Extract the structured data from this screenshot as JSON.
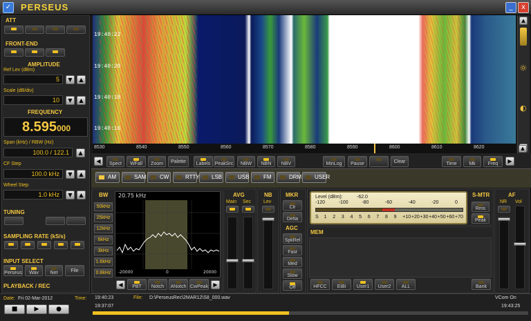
{
  "app": {
    "title": "PERSEUS",
    "icon": "app-icon"
  },
  "window": {
    "minimize_label": "_",
    "close_label": "x"
  },
  "left": {
    "att_title": "ATT",
    "frontend_title": "FRONT-END",
    "amplitude_title": "AMPLITUDE",
    "ref_lev_label": "Ref Lev (dBm)",
    "ref_lev_value": "5",
    "scale_label": "Scale (dB/div)",
    "scale_value": "10",
    "frequency_title": "FREQUENCY",
    "freq_main": "8.595",
    "freq_sub": "000",
    "span_label": "Span (kHz) / RBW (Hz)",
    "span_value": "100.0 / 122.1",
    "cfstep_label": "CF Step",
    "cfstep_value": "100.0 kHz",
    "wheelstep_label": "Wheel Step",
    "wheelstep_value": "1.0 kHz",
    "tuning_title": "TUNING",
    "sampling_title": "SAMPLING RATE (kS/s)",
    "input_title": "INPUT SELECT",
    "input_buttons": [
      "Perseus",
      "Wav",
      "Net",
      "File"
    ],
    "playback_title": "PLAYBACK / REC"
  },
  "waterfall": {
    "timestamps": [
      "19:40:22",
      "19:40:20",
      "19:40:18",
      "19:40:16"
    ]
  },
  "freq_axis": {
    "ticks": [
      "8530",
      "8540",
      "8550",
      "8560",
      "8570",
      "8580",
      "8590",
      "8600",
      "8610",
      "8620"
    ]
  },
  "toolbar": {
    "left_buttons": [
      "Spect",
      "WFall",
      "Zoom",
      "Palette",
      "Labels",
      "PeakSrc",
      "NBW",
      "NBN",
      "NBV",
      "MinLog",
      "Pause",
      "",
      "Clear"
    ],
    "right_buttons": [
      "Time",
      "Mk",
      "Freq"
    ]
  },
  "modes": [
    {
      "label": "AM",
      "active": true
    },
    {
      "label": "SAM",
      "active": false
    },
    {
      "label": "CW",
      "active": false
    },
    {
      "label": "RTTY",
      "active": false
    },
    {
      "label": "LSB",
      "active": false
    },
    {
      "label": "USB",
      "active": false
    },
    {
      "label": "FM",
      "active": false
    },
    {
      "label": "DRM",
      "active": false
    },
    {
      "label": "USER",
      "active": false
    }
  ],
  "bw": {
    "title": "BW",
    "readout": "20.75 kHz",
    "buttons": [
      "50kHz",
      "25kHz",
      "12kHz",
      "6kHz",
      "3kHz",
      "1.6kHz",
      "0.8kHz"
    ],
    "axis": [
      "-20000",
      "0",
      "20000"
    ],
    "bottom_buttons": [
      "PBT",
      "Notch",
      "ANotch",
      "CwPeak"
    ]
  },
  "avg": {
    "title": "AVG",
    "main": "Main",
    "sec": "Sec"
  },
  "nb": {
    "title": "NB",
    "lev": "Lev"
  },
  "mkr": {
    "title": "MKR",
    "buttons": [
      "Clr",
      "Delta"
    ]
  },
  "agc": {
    "title": "AGC",
    "buttons": [
      "SpkRel",
      "Fast",
      "Med",
      "Slow",
      "Off"
    ]
  },
  "smeter": {
    "title": "S-MTR",
    "level_label": "Level (dBm):",
    "level_value": "-62.0",
    "level_fraction": 0.5,
    "dbm_scale": [
      "-120",
      "-100",
      "-80",
      "-60",
      "-40",
      "-20",
      "0"
    ],
    "s_scale": [
      "S",
      "1",
      "2",
      "3",
      "4",
      "5",
      "6",
      "7",
      "8",
      "9",
      "+10",
      "+20",
      "+30",
      "+40",
      "+50",
      "+60",
      "+70"
    ],
    "buttons": [
      "Rms",
      "Peak"
    ]
  },
  "af": {
    "title": "AF",
    "nr": "NR",
    "vol": "Vol"
  },
  "mem": {
    "title": "MEM",
    "buttons": [
      "HFCC",
      "EiBi",
      "User1",
      "User2",
      "ALL"
    ],
    "bank": "Bank"
  },
  "status": {
    "date_label": "Date:",
    "date_value": "Fri 02-Mar-2012",
    "time_label": "Time:",
    "time_value": "19:40:23",
    "file_label": "File:",
    "file_value": "D:\\PerseusRec\\2MAR12\\S8_000.wav",
    "start_time": "19:37:07",
    "end_time": "19:43:25",
    "vcom": "VCom On",
    "progress_fraction": 0.45
  },
  "colors": {
    "accent": "#f0c020",
    "background": "#181818",
    "meter_bg": "#efe6c0"
  }
}
